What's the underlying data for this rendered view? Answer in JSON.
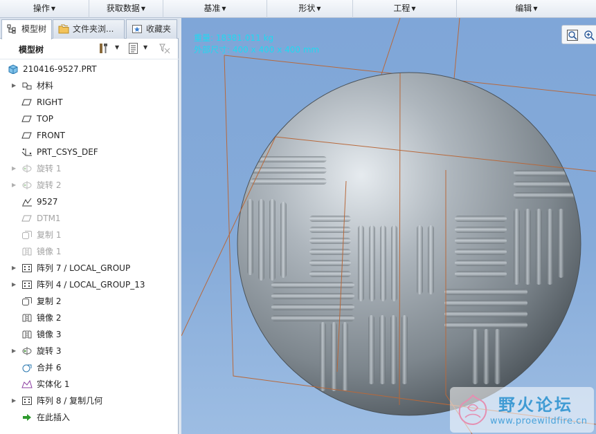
{
  "menubar": {
    "items": [
      {
        "label": "操作"
      },
      {
        "label": "获取数据"
      },
      {
        "label": "基准"
      },
      {
        "label": "形状"
      },
      {
        "label": "工程"
      },
      {
        "label": "编辑"
      }
    ]
  },
  "left_panel": {
    "tabs": [
      {
        "label": "模型树",
        "icon": "model-tree-icon",
        "active": true
      },
      {
        "label": "文件夹浏...",
        "icon": "folder-browser-icon",
        "active": false
      },
      {
        "label": "收藏夹",
        "icon": "favorites-icon",
        "active": false
      }
    ],
    "tree_title": "模型树",
    "toolbar_icons": [
      "tools-icon",
      "settings-list-icon",
      "filter-icon"
    ],
    "tree": [
      {
        "label": "210416-9527.PRT",
        "icon": "part-icon",
        "expandable": false,
        "dim": false,
        "root": true
      },
      {
        "label": "材料",
        "icon": "material-icon",
        "expandable": true,
        "dim": false
      },
      {
        "label": "RIGHT",
        "icon": "datum-plane-icon",
        "expandable": false,
        "dim": false
      },
      {
        "label": "TOP",
        "icon": "datum-plane-icon",
        "expandable": false,
        "dim": false
      },
      {
        "label": "FRONT",
        "icon": "datum-plane-icon",
        "expandable": false,
        "dim": false
      },
      {
        "label": "PRT_CSYS_DEF",
        "icon": "csys-icon",
        "expandable": false,
        "dim": false
      },
      {
        "label": "旋转 1",
        "icon": "revolve-icon",
        "expandable": true,
        "dim": true
      },
      {
        "label": "旋转 2",
        "icon": "revolve-icon",
        "expandable": true,
        "dim": true
      },
      {
        "label": "9527",
        "icon": "sketch-icon",
        "expandable": false,
        "dim": false
      },
      {
        "label": "DTM1",
        "icon": "datum-plane-icon",
        "expandable": false,
        "dim": true
      },
      {
        "label": "复制 1",
        "icon": "copy-icon",
        "expandable": false,
        "dim": true
      },
      {
        "label": "镜像 1",
        "icon": "mirror-icon",
        "expandable": false,
        "dim": true
      },
      {
        "label": "阵列 7 / LOCAL_GROUP",
        "icon": "pattern-icon",
        "expandable": true,
        "dim": false
      },
      {
        "label": "阵列 4 / LOCAL_GROUP_13",
        "icon": "pattern-icon",
        "expandable": true,
        "dim": false
      },
      {
        "label": "复制 2",
        "icon": "copy-icon",
        "expandable": false,
        "dim": false
      },
      {
        "label": "镜像 2",
        "icon": "mirror-icon",
        "expandable": false,
        "dim": false
      },
      {
        "label": "镜像 3",
        "icon": "mirror-icon",
        "expandable": false,
        "dim": false
      },
      {
        "label": "旋转 3",
        "icon": "revolve-icon",
        "expandable": true,
        "dim": false
      },
      {
        "label": "合并 6",
        "icon": "merge-icon",
        "expandable": false,
        "dim": false
      },
      {
        "label": "实体化 1",
        "icon": "solidify-icon",
        "expandable": false,
        "dim": false
      },
      {
        "label": "阵列 8 / 复制几何",
        "icon": "pattern-icon",
        "expandable": true,
        "dim": false
      },
      {
        "label": "在此插入",
        "icon": "insert-here-icon",
        "expandable": false,
        "dim": false
      }
    ]
  },
  "viewport": {
    "info_line1": "重量: 18381.011 kg",
    "info_line2": "外部尺寸: 400 x 400 x 400 mm",
    "view_tools": [
      "zoom-fit-icon",
      "zoom-in-icon"
    ]
  },
  "watermark": {
    "title": "野火论坛",
    "url": "www.proewildfire.cn"
  },
  "colors": {
    "info_text": "#21d8f0",
    "viewport_bg": "#86abd9",
    "datum_plane_edge": "#b8683a",
    "sphere": "#9ea6ad"
  }
}
